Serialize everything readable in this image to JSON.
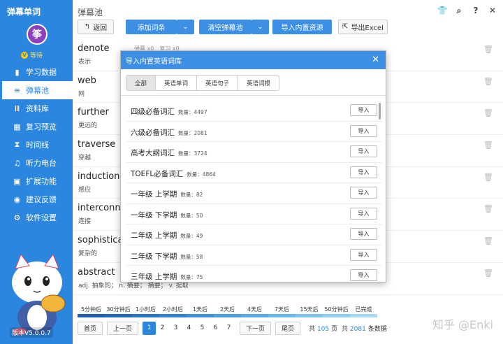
{
  "app": {
    "title": "弹幕单词",
    "user_initial": "筝",
    "vip_label": "等待",
    "version": "版本V5.0.0.7"
  },
  "sidebar": {
    "items": [
      {
        "label": "学习数据",
        "icon": "bar-chart-icon"
      },
      {
        "label": "弹幕池",
        "icon": "list-icon"
      },
      {
        "label": "资料库",
        "icon": "books-icon"
      },
      {
        "label": "复习预览",
        "icon": "calendar-icon"
      },
      {
        "label": "时间线",
        "icon": "hourglass-icon"
      },
      {
        "label": "听力电台",
        "icon": "headphones-icon"
      },
      {
        "label": "扩展功能",
        "icon": "grid-icon"
      },
      {
        "label": "建议反馈",
        "icon": "location-icon"
      },
      {
        "label": "软件设置",
        "icon": "gear-icon"
      }
    ],
    "active_index": 1
  },
  "main": {
    "title": "弹幕池",
    "toolbar": {
      "back": "返回",
      "add": "添加词条",
      "clear": "清空弹幕池",
      "import_builtin": "导入内置资源",
      "export": "导出Excel"
    },
    "words": [
      {
        "en": "denote",
        "cn": "表示",
        "meta1": "弹幕 x0",
        "meta2": "复习 x0"
      },
      {
        "en": "web",
        "cn": "网"
      },
      {
        "en": "further",
        "cn": "更远的"
      },
      {
        "en": "traverse",
        "cn": "穿越"
      },
      {
        "en": "induction",
        "cn": "感应"
      },
      {
        "en": "interconne",
        "cn": "连接"
      },
      {
        "en": "sophisticat",
        "cn": "复杂的"
      },
      {
        "en": "abstract",
        "cn": "adj. 抽象的；  n. 摘要；  摘要；  v. 提取"
      }
    ],
    "timeline": [
      {
        "label": "5分钟后",
        "color": "#1f5fb0"
      },
      {
        "label": "30分钟后",
        "color": "#2468bd"
      },
      {
        "label": "1小时后",
        "color": "#2b74c9"
      },
      {
        "label": "2小时后",
        "color": "#3381d2"
      },
      {
        "label": "1天后",
        "color": "#3e8fda"
      },
      {
        "label": "2天后",
        "color": "#4b9de0"
      },
      {
        "label": "4天后",
        "color": "#5aaae5"
      },
      {
        "label": "7天后",
        "color": "#6bb8ea"
      },
      {
        "label": "15天后",
        "color": "#7dc4ee"
      },
      {
        "label": "50分钟后",
        "color": "#91cff1"
      },
      {
        "label": "已完成",
        "color": "#a7daf4"
      }
    ],
    "pager": {
      "first": "首页",
      "prev": "上一页",
      "next": "下一页",
      "last": "尾页",
      "pages": [
        "1",
        "2",
        "3",
        "4",
        "5",
        "6",
        "7"
      ],
      "current": "1",
      "total_pages_prefix": "共",
      "total_pages": "105",
      "total_pages_suffix": "页",
      "total_items_prefix": "共",
      "total_items": "2081",
      "total_items_suffix": "条数据"
    },
    "watermark": "知乎 @Enki"
  },
  "modal": {
    "title": "导入内置英语词库",
    "tabs": [
      "全部",
      "英语单词",
      "英语句子",
      "英语词根"
    ],
    "active_tab": 0,
    "count_prefix": "数量：",
    "import_label": "导入",
    "libraries": [
      {
        "name": "四级必备词汇",
        "count": "4497"
      },
      {
        "name": "六级必备词汇",
        "count": "2081"
      },
      {
        "name": "高考大纲词汇",
        "count": "3724"
      },
      {
        "name": "TOEFL必备词汇",
        "count": "4864"
      },
      {
        "name": "一年级 上学期",
        "count": "82"
      },
      {
        "name": "一年级 下学期",
        "count": "50"
      },
      {
        "name": "二年级 上学期",
        "count": "49"
      },
      {
        "name": "二年级 下学期",
        "count": "58"
      },
      {
        "name": "三年级 上学期",
        "count": "75"
      }
    ]
  }
}
